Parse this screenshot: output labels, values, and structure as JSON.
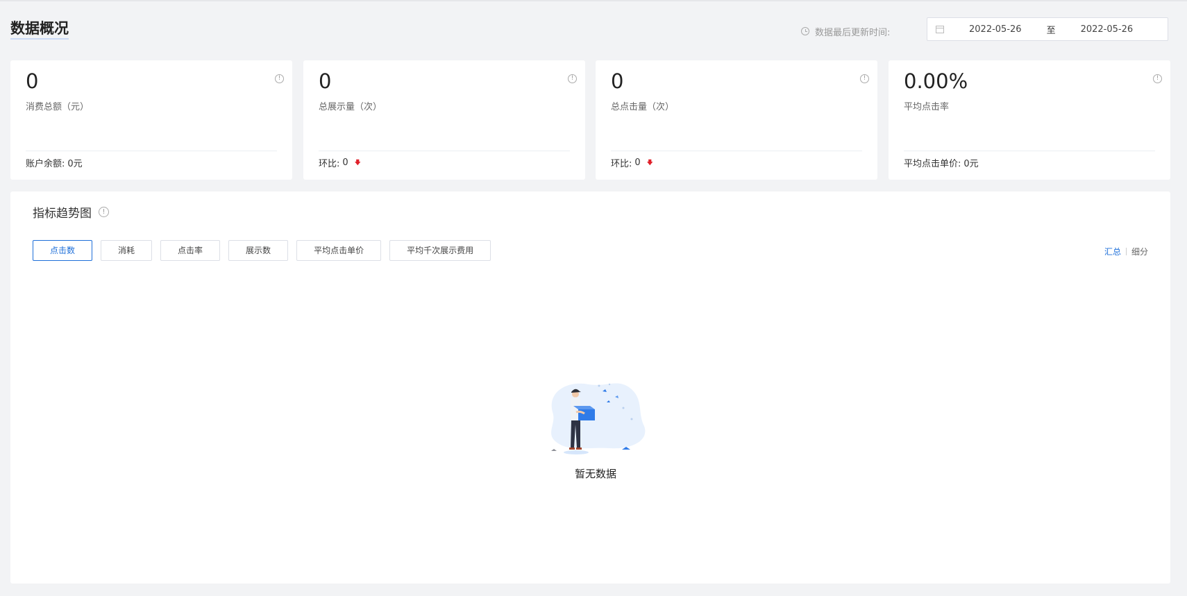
{
  "header": {
    "title": "数据概况",
    "update_label": "数据最后更新时间:",
    "date_start": "2022-05-26",
    "date_sep": "至",
    "date_end": "2022-05-26"
  },
  "cards": [
    {
      "value": "0",
      "name": "消费总额（元）",
      "foot_label": "账户余额:",
      "foot_value": "0元",
      "arrow": false
    },
    {
      "value": "0",
      "name": "总展示量（次）",
      "foot_label": "环比:",
      "foot_value": "0",
      "arrow": true
    },
    {
      "value": "0",
      "name": "总点击量（次）",
      "foot_label": "环比:",
      "foot_value": "0",
      "arrow": true
    },
    {
      "value": "0.00%",
      "name": "平均点击率",
      "foot_label": "平均点击单价:",
      "foot_value": "0元",
      "arrow": false
    }
  ],
  "trend": {
    "title": "指标趋势图",
    "tabs": [
      "点击数",
      "消耗",
      "点击率",
      "展示数",
      "平均点击单价",
      "平均千次展示费用"
    ],
    "active_tab": "点击数",
    "view_summary": "汇总",
    "view_detail": "细分",
    "empty_text": "暂无数据"
  },
  "colors": {
    "accent": "#1e6fd9",
    "down": "#e0202a"
  }
}
